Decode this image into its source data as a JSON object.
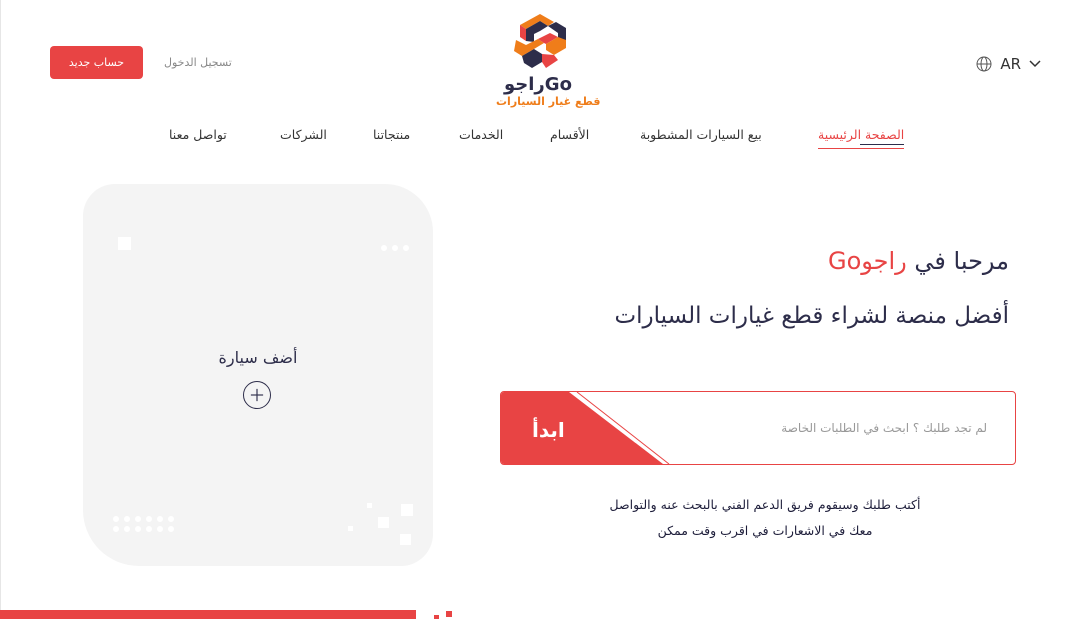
{
  "header": {
    "language": "AR",
    "brand_name": "راجوGo",
    "brand_tagline": "قطع غيار السيارات",
    "register_button": "حساب جديد",
    "login_link": "تسجيل الدخول"
  },
  "nav": {
    "items": [
      {
        "label": "الصفحة الرئيسية",
        "active": true
      },
      {
        "label": "بيع السيارات المشطوبة"
      },
      {
        "label": "الأقسام"
      },
      {
        "label": "الخدمات"
      },
      {
        "label": "منتجاتنا"
      },
      {
        "label": "الشركات"
      },
      {
        "label": "تواصل معنا"
      }
    ]
  },
  "add_car": {
    "label": "أضف سيارة"
  },
  "hero": {
    "welcome_prefix": "مرحبا في",
    "welcome_brand": "راجوGo",
    "tagline": "أفضل منصة لشراء قطع غيارات السيارات",
    "search_placeholder": "لم تجد طلبك ؟ ابحث في الطلبات الخاصة",
    "start_button": "ابدأ",
    "help_line1": "أكتب طلبك وسيقوم فريق الدعم الفني بالبحث عنه والتواصل",
    "help_line2": "معك في الاشعارات في اقرب وقت ممكن"
  },
  "colors": {
    "accent": "#e84444",
    "dark": "#2d2d4a",
    "logo_orange": "#ef7d1a"
  }
}
